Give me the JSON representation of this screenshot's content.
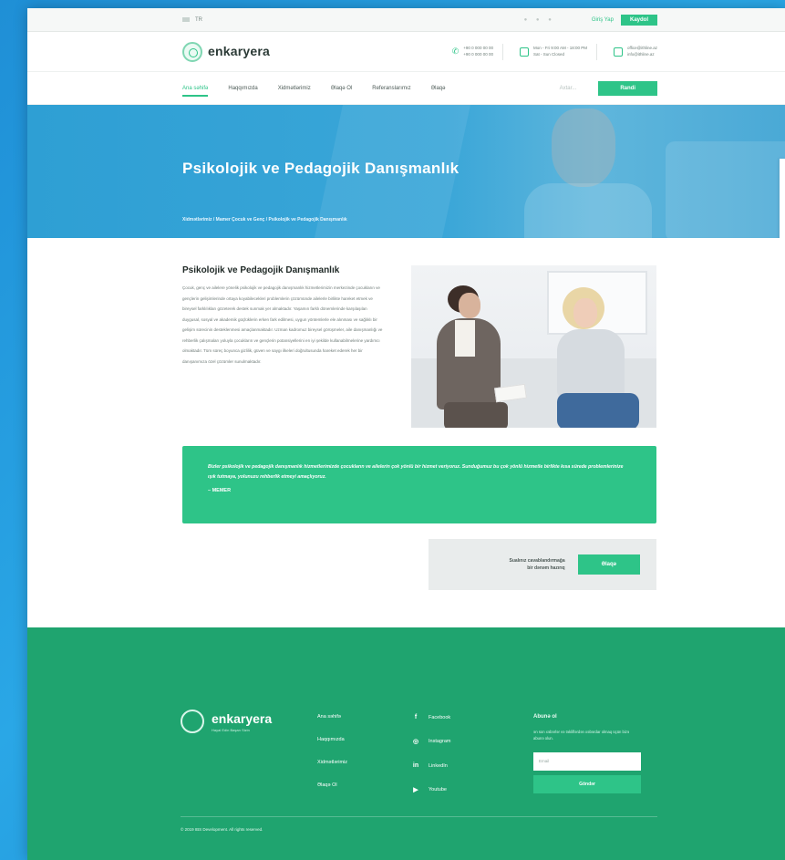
{
  "topbar": {
    "lang": "TR",
    "signin_label": "Giriş Yap",
    "register_label": "Kaydol"
  },
  "header": {
    "logo_name": "enkaryera",
    "logo_sub": "",
    "phone_1": "+90 0 000 00 00",
    "phone_2": "+90 0 000 00 00",
    "hours_1": "Mon - Fri 9:00 AM - 18:00 PM",
    "hours_2": "Sat - Sun Closed",
    "email_1": "office@ithline.az",
    "email_2": "info@ithline.az"
  },
  "nav": {
    "items": [
      "Ana səhifə",
      "Haqqımızda",
      "Xidmətlərimiz",
      "Əlaqə Ol",
      "Referanslarımız",
      "Əlaqə"
    ],
    "active_index": 0,
    "search_placeholder": "Axtar...",
    "cta_label": "Randi"
  },
  "hero": {
    "title": "Psikolojik ve Pedagojik Danışmanlık",
    "breadcrumb": "Xidmətlərimiz / Mamer Çocuk ve Genç / Psikolojik ve Pedagojik Danışmanlık"
  },
  "article": {
    "title": "Psikolojik ve Pedagojik Danışmanlık",
    "body": "Çocuk, genç ve ailelere yönelik psikolojik ve pedagojik danışmanlık hizmetlerimizin merkezinde çocukların ve gençlerin gelişimlerinde ortaya koyabilecekleri problemlerin çözümünde ailelerle birlikte hareket etmek ve bireysel farklılıkları gözeterek destek sunmak yer almaktadır. Yaşamın farklı dönemlerinde karşılaşılan duygusal, sosyal ve akademik güçlüklerin erken fark edilmesi, uygun yöntemlerle ele alınması ve sağlıklı bir gelişim sürecinin desteklenmesi amaçlanmaktadır. Uzman kadromuz bireysel görüşmeler, aile danışmanlığı ve rehberlik çalışmaları yoluyla çocukların ve gençlerin potansiyellerini en iyi şekilde kullanabilmelerine yardımcı olmaktadır. Tüm süreç boyunca gizlilik, güven ve saygı ilkeleri doğrultusunda hareket ederek her bir danışanımıza özel çözümler sunulmaktadır."
  },
  "quote": {
    "text": "Bizler psikolojik ve pedagojik danışmanlık hizmetlerimizde çocukların ve ailelerin çok yönlü bir hizmet veriyoruz. Sunduğumuz bu çok yönlü hizmetle birlikte kısa sürede problemlerinize ışık tutmaya, yolunuzu rehberlik etmeyi amaçlıyoruz.",
    "author": "– MEMER"
  },
  "callout": {
    "text_1": "Sualınız cavablandırmağa",
    "text_2": "bir dənəm hazırıq",
    "button_label": "Əlaqə"
  },
  "footer": {
    "logo_name": "enkaryera",
    "logo_sub": "Hayal Edin Başarı Sizin",
    "links": [
      "Ana səhifə",
      "Haqqımızda",
      "Xidmətlərimiz",
      "Əlaqə Ol"
    ],
    "social": [
      {
        "icon": "facebook-icon",
        "glyph": "f",
        "label": "Facebook"
      },
      {
        "icon": "instagram-icon",
        "glyph": "◎",
        "label": "Instagram"
      },
      {
        "icon": "linkedin-icon",
        "glyph": "in",
        "label": "LinkedIn"
      },
      {
        "icon": "youtube-icon",
        "glyph": "▶",
        "label": "Youtube"
      }
    ],
    "newsletter_title": "Abunə ol",
    "newsletter_desc": "ən son xəbərlər və təkliflərdən xəbərdar olmaq üçün bizə abunə olun.",
    "email_placeholder": "Email",
    "subscribe_label": "Göndər",
    "copyright": "© 2019 IBS Development. All rights reserved."
  },
  "colors": {
    "accent": "#2ec488",
    "hero_blue": "#3aa6d8",
    "footer_green": "#1fa46f"
  }
}
